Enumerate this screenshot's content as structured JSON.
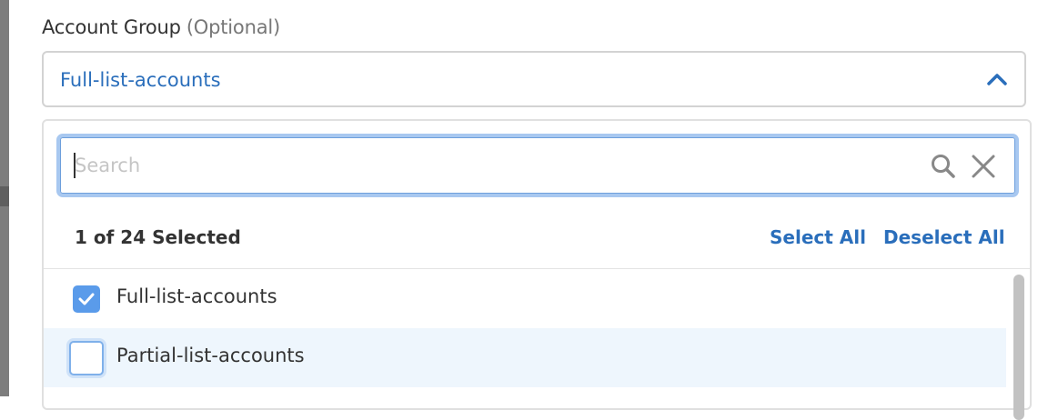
{
  "field": {
    "label": "Account Group",
    "optional": "(Optional)",
    "value": "Full-list-accounts"
  },
  "dropdown": {
    "search_placeholder": "Search",
    "search_value": "",
    "selection_count": "1 of 24 Selected",
    "select_all_label": "Select All",
    "deselect_all_label": "Deselect All",
    "options": [
      {
        "label": "Full-list-accounts",
        "checked": true
      },
      {
        "label": "Partial-list-accounts",
        "checked": false
      }
    ]
  },
  "colors": {
    "accent": "#2a6ebb",
    "checkbox_checked": "#5a9bea",
    "focus_ring": "#a8c8f0",
    "hover_row": "#eef6fd"
  },
  "icons": {
    "select_toggle": "chevron-up-icon",
    "search": "search-icon",
    "clear": "close-icon",
    "checkmark": "checkmark-icon"
  }
}
